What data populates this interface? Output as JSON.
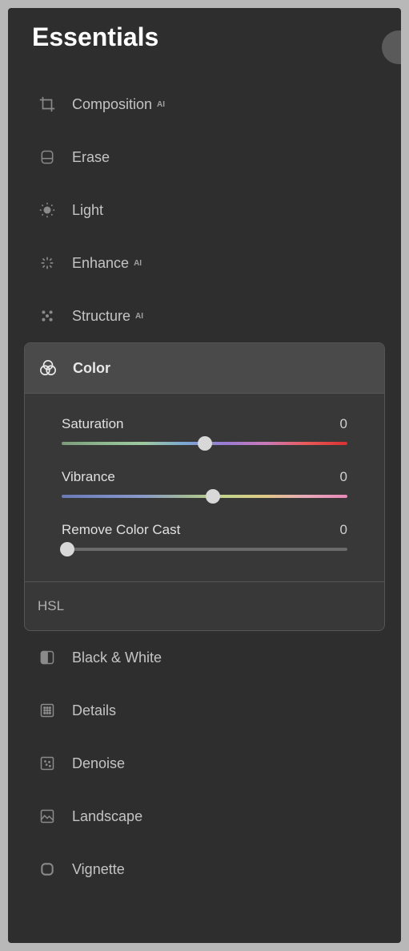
{
  "title": "Essentials",
  "tools": {
    "composition": {
      "label": "Composition",
      "ai": "AI"
    },
    "erase": {
      "label": "Erase"
    },
    "light": {
      "label": "Light"
    },
    "enhance": {
      "label": "Enhance",
      "ai": "AI"
    },
    "structure": {
      "label": "Structure",
      "ai": "AI"
    },
    "color": {
      "label": "Color"
    },
    "black_white": {
      "label": "Black & White"
    },
    "details": {
      "label": "Details"
    },
    "denoise": {
      "label": "Denoise"
    },
    "landscape": {
      "label": "Landscape"
    },
    "vignette": {
      "label": "Vignette"
    }
  },
  "color_panel": {
    "saturation": {
      "label": "Saturation",
      "value": "0"
    },
    "vibrance": {
      "label": "Vibrance",
      "value": "0"
    },
    "remove_cast": {
      "label": "Remove Color Cast",
      "value": "0"
    },
    "hsl": {
      "label": "HSL"
    }
  }
}
